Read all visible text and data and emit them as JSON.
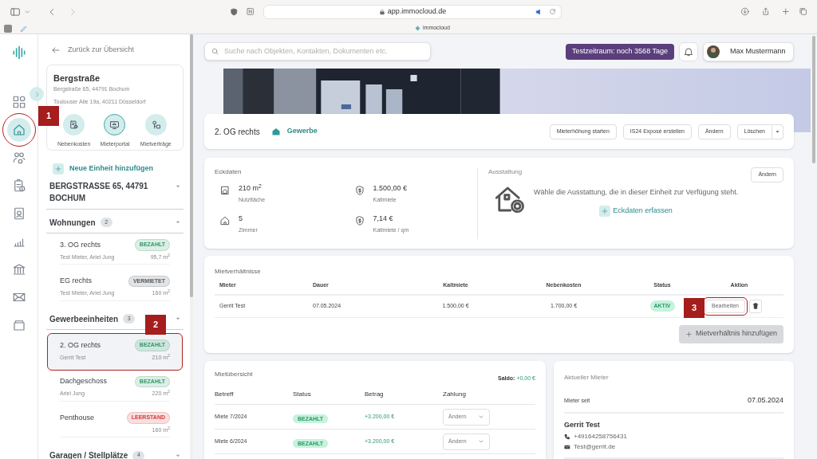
{
  "browser": {
    "url": "app.immocloud.de",
    "tab_title": "immocloud"
  },
  "rail": {
    "items": [
      {
        "selected": false,
        "highlighted": false
      },
      {
        "selected": true,
        "highlighted": true
      },
      {
        "selected": false,
        "highlighted": false
      },
      {
        "selected": false,
        "highlighted": false
      },
      {
        "selected": false,
        "highlighted": false
      },
      {
        "selected": false,
        "highlighted": false
      },
      {
        "selected": false,
        "highlighted": false
      },
      {
        "selected": false,
        "highlighted": false
      },
      {
        "selected": false,
        "highlighted": false
      }
    ]
  },
  "sidebar": {
    "back_link": "Zurück zur Übersicht",
    "property": {
      "name": "Bergstraße",
      "address": "Bergstraße 65, 44791 Bochum",
      "owner_address": "Toulouser Alle 19a, 40211 Düsseldorf",
      "shortcuts": [
        {
          "label": "Nebenkosten",
          "selected": false
        },
        {
          "label": "Mieterportal",
          "selected": true
        },
        {
          "label": "Mietverträge",
          "selected": false
        }
      ]
    },
    "add_unit": "Neue Einheit hinzufügen",
    "building": "BERGSTRASSE 65, 44791 BOCHUM",
    "groups": [
      {
        "name": "Wohnungen",
        "count": "2",
        "units": [
          {
            "name": "3. OG rechts",
            "badge": "BEZAHLT",
            "color": "#2e9a6a",
            "tenants": "Test Mieter, Ariel Jung",
            "area": "95,7 m$^{2}$",
            "selected": false,
            "highlighted": false
          },
          {
            "name": "EG rechts",
            "badge": "VERMIETET",
            "color": "#555c63",
            "tenants": "Test Mieter, Ariel Jung",
            "area": "160 m$^{2}$",
            "selected": false,
            "highlighted": false
          }
        ]
      },
      {
        "name": "Gewerbeeinheiten",
        "count": "3",
        "units": [
          {
            "name": "2. OG rechts",
            "badge": "BEZAHLT",
            "color": "#2e9a6a",
            "tenants": "Gerrit Test",
            "area": "210 m$^{2}$",
            "selected": true,
            "highlighted": true
          },
          {
            "name": "Dachgeschoss",
            "badge": "BEZAHLT",
            "color": "#2e9a6a",
            "tenants": "Ariel Jung",
            "area": "220 m$^{2}$",
            "selected": false,
            "highlighted": false
          },
          {
            "name": "Penthouse",
            "badge": "LEERSTAND",
            "color": "#d63a3a",
            "area": "160 m$^{2}$",
            "selected": false,
            "highlighted": false
          }
        ]
      },
      {
        "name": "Garagen / Stellplätze",
        "count": "4"
      }
    ]
  },
  "topbar": {
    "search_placeholder": "Suche nach Objekten, Kontakten, Dokumenten etc.",
    "trial": "Testzeitraum: noch 3568 Tage",
    "user": "Max Mustermann"
  },
  "unit_header": {
    "title": "2. OG rechts",
    "type": "Gewerbe",
    "buttons": [
      "Mieterhöhung starten",
      "IS24 Exposé erstellen",
      "Ändern",
      "Löschen"
    ]
  },
  "key_data": {
    "title": "Eckdaten",
    "stats": [
      {
        "value": "210 m$^{2}$",
        "label": "Nutzfläche"
      },
      {
        "value": "1.500,00 €",
        "label": "Kaltmiete"
      },
      {
        "value": "5",
        "label": "Zimmer"
      },
      {
        "value": "7,14 €",
        "label": "Kaltmiete / qm"
      }
    ]
  },
  "equipment": {
    "title": "Ausstattung",
    "edit": "Ändern",
    "hint": "Wähle die Ausstattung, die in dieser Einheit zur Verfügung steht.",
    "action": "Eckdaten erfassen"
  },
  "tenancies": {
    "title": "Mietverhältnisse",
    "columns": [
      "Mieter",
      "Dauer",
      "Kaltmiete",
      "Nebenkosten",
      "Status",
      "Aktion"
    ],
    "rows": [
      {
        "tenant": "Gerrit Test",
        "start": "07.05.2024",
        "rent": "1.500,00 €",
        "costs": "1.700,00 €",
        "status": "AKTIV",
        "edit": "Bearbeiten",
        "highlighted": true
      }
    ],
    "add": "Mietverhältnis hinzufügen"
  },
  "rent_overview": {
    "title": "Mietübersicht",
    "balance_label": "Saldo:",
    "balance": "+0,00 €",
    "columns": [
      "Betreff",
      "Status",
      "Betrag",
      "Zahlung"
    ],
    "rows": [
      {
        "subject": "Miete 7/2024",
        "status": "BEZAHLT",
        "amount": "+3.200,00 €",
        "payment": "Ändern"
      },
      {
        "subject": "Miete 6/2024",
        "status": "BEZAHLT",
        "amount": "+3.200,00 €",
        "payment": "Ändern"
      }
    ]
  },
  "current_tenant": {
    "title": "Aktueller Mieter",
    "since_label": "Mieter seit",
    "since": "07.05.2024",
    "name": "Gerrit Test",
    "phone": "+49164258756431",
    "email": "Test@gerrit.de"
  },
  "annotations": [
    {
      "label": "1"
    },
    {
      "label": "2"
    },
    {
      "label": "3"
    }
  ]
}
